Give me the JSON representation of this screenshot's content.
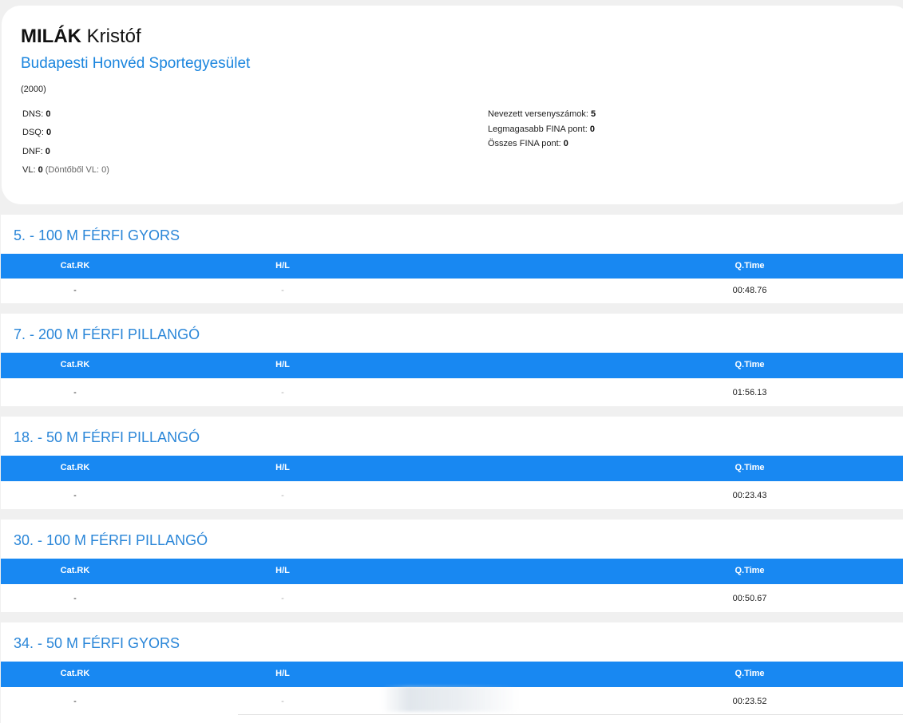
{
  "athlete": {
    "surname": "MILÁK",
    "given_name": "Kristóf",
    "club": "Budapesti Honvéd Sportegyesület",
    "birth_year": "(2000)"
  },
  "stats_left": [
    {
      "label": "DNS:",
      "value": "0",
      "note": ""
    },
    {
      "label": "DSQ:",
      "value": "0",
      "note": ""
    },
    {
      "label": "DNF:",
      "value": "0",
      "note": ""
    },
    {
      "label": "VL:",
      "value": "0",
      "note": "(Döntőből VL: 0)"
    }
  ],
  "stats_right": [
    {
      "label": "Nevezett versenyszámok:",
      "value": "5"
    },
    {
      "label": "Legmagasabb FINA pont:",
      "value": "0"
    },
    {
      "label": "Összes FINA pont:",
      "value": "0"
    }
  ],
  "table_columns": {
    "cat_rk": "Cat.RK",
    "hl": "H/L",
    "qtime": "Q.Time"
  },
  "events": [
    {
      "title": "5. - 100 M FÉRFI GYORS",
      "cat_rk": "-",
      "hl": "-",
      "qtime": "00:48.76"
    },
    {
      "title": "7. - 200 M FÉRFI PILLANGÓ",
      "cat_rk": "-",
      "hl": "-",
      "qtime": "01:56.13"
    },
    {
      "title": "18. - 50 M FÉRFI PILLANGÓ",
      "cat_rk": "-",
      "hl": "-",
      "qtime": "00:23.43"
    },
    {
      "title": "30. - 100 M FÉRFI PILLANGÓ",
      "cat_rk": "-",
      "hl": "-",
      "qtime": "00:50.67"
    },
    {
      "title": "34. - 50 M FÉRFI GYORS",
      "cat_rk": "-",
      "hl": "-",
      "qtime": "00:23.52"
    }
  ],
  "colors": {
    "accent": "#1888f2",
    "link": "#1a85de",
    "page_bg": "#f0f0f0"
  }
}
